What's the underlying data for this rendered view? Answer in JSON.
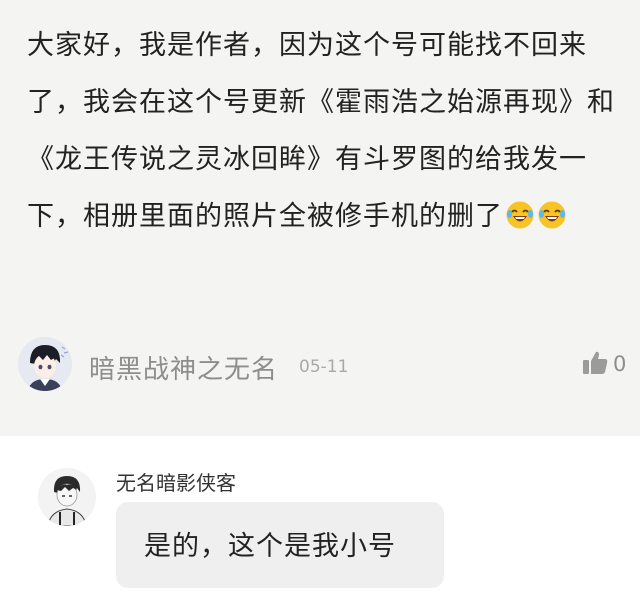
{
  "post": {
    "text": "大家好，我是作者，因为这个号可能找不回来了，我会在这个号更新《霍雨浩之始源再现》和《龙王传说之灵冰回眸》有斗罗图的给我发一下，相册里面的照片全被修手机的删了",
    "emojis": [
      "laughing-tears-emoji",
      "laughing-tears-emoji"
    ],
    "author": "暗黑战神之无名",
    "date": "05-11",
    "like_count": "0",
    "like_icon": "thumbs-up-icon"
  },
  "reply": {
    "author": "无名暗影侠客",
    "text": "是的，这个是我小号"
  },
  "colors": {
    "post_background": "#f4f4f2",
    "bubble_background": "#efefef",
    "meta_text": "#8d8d8d",
    "emoji_yellow": "#f7c325"
  }
}
